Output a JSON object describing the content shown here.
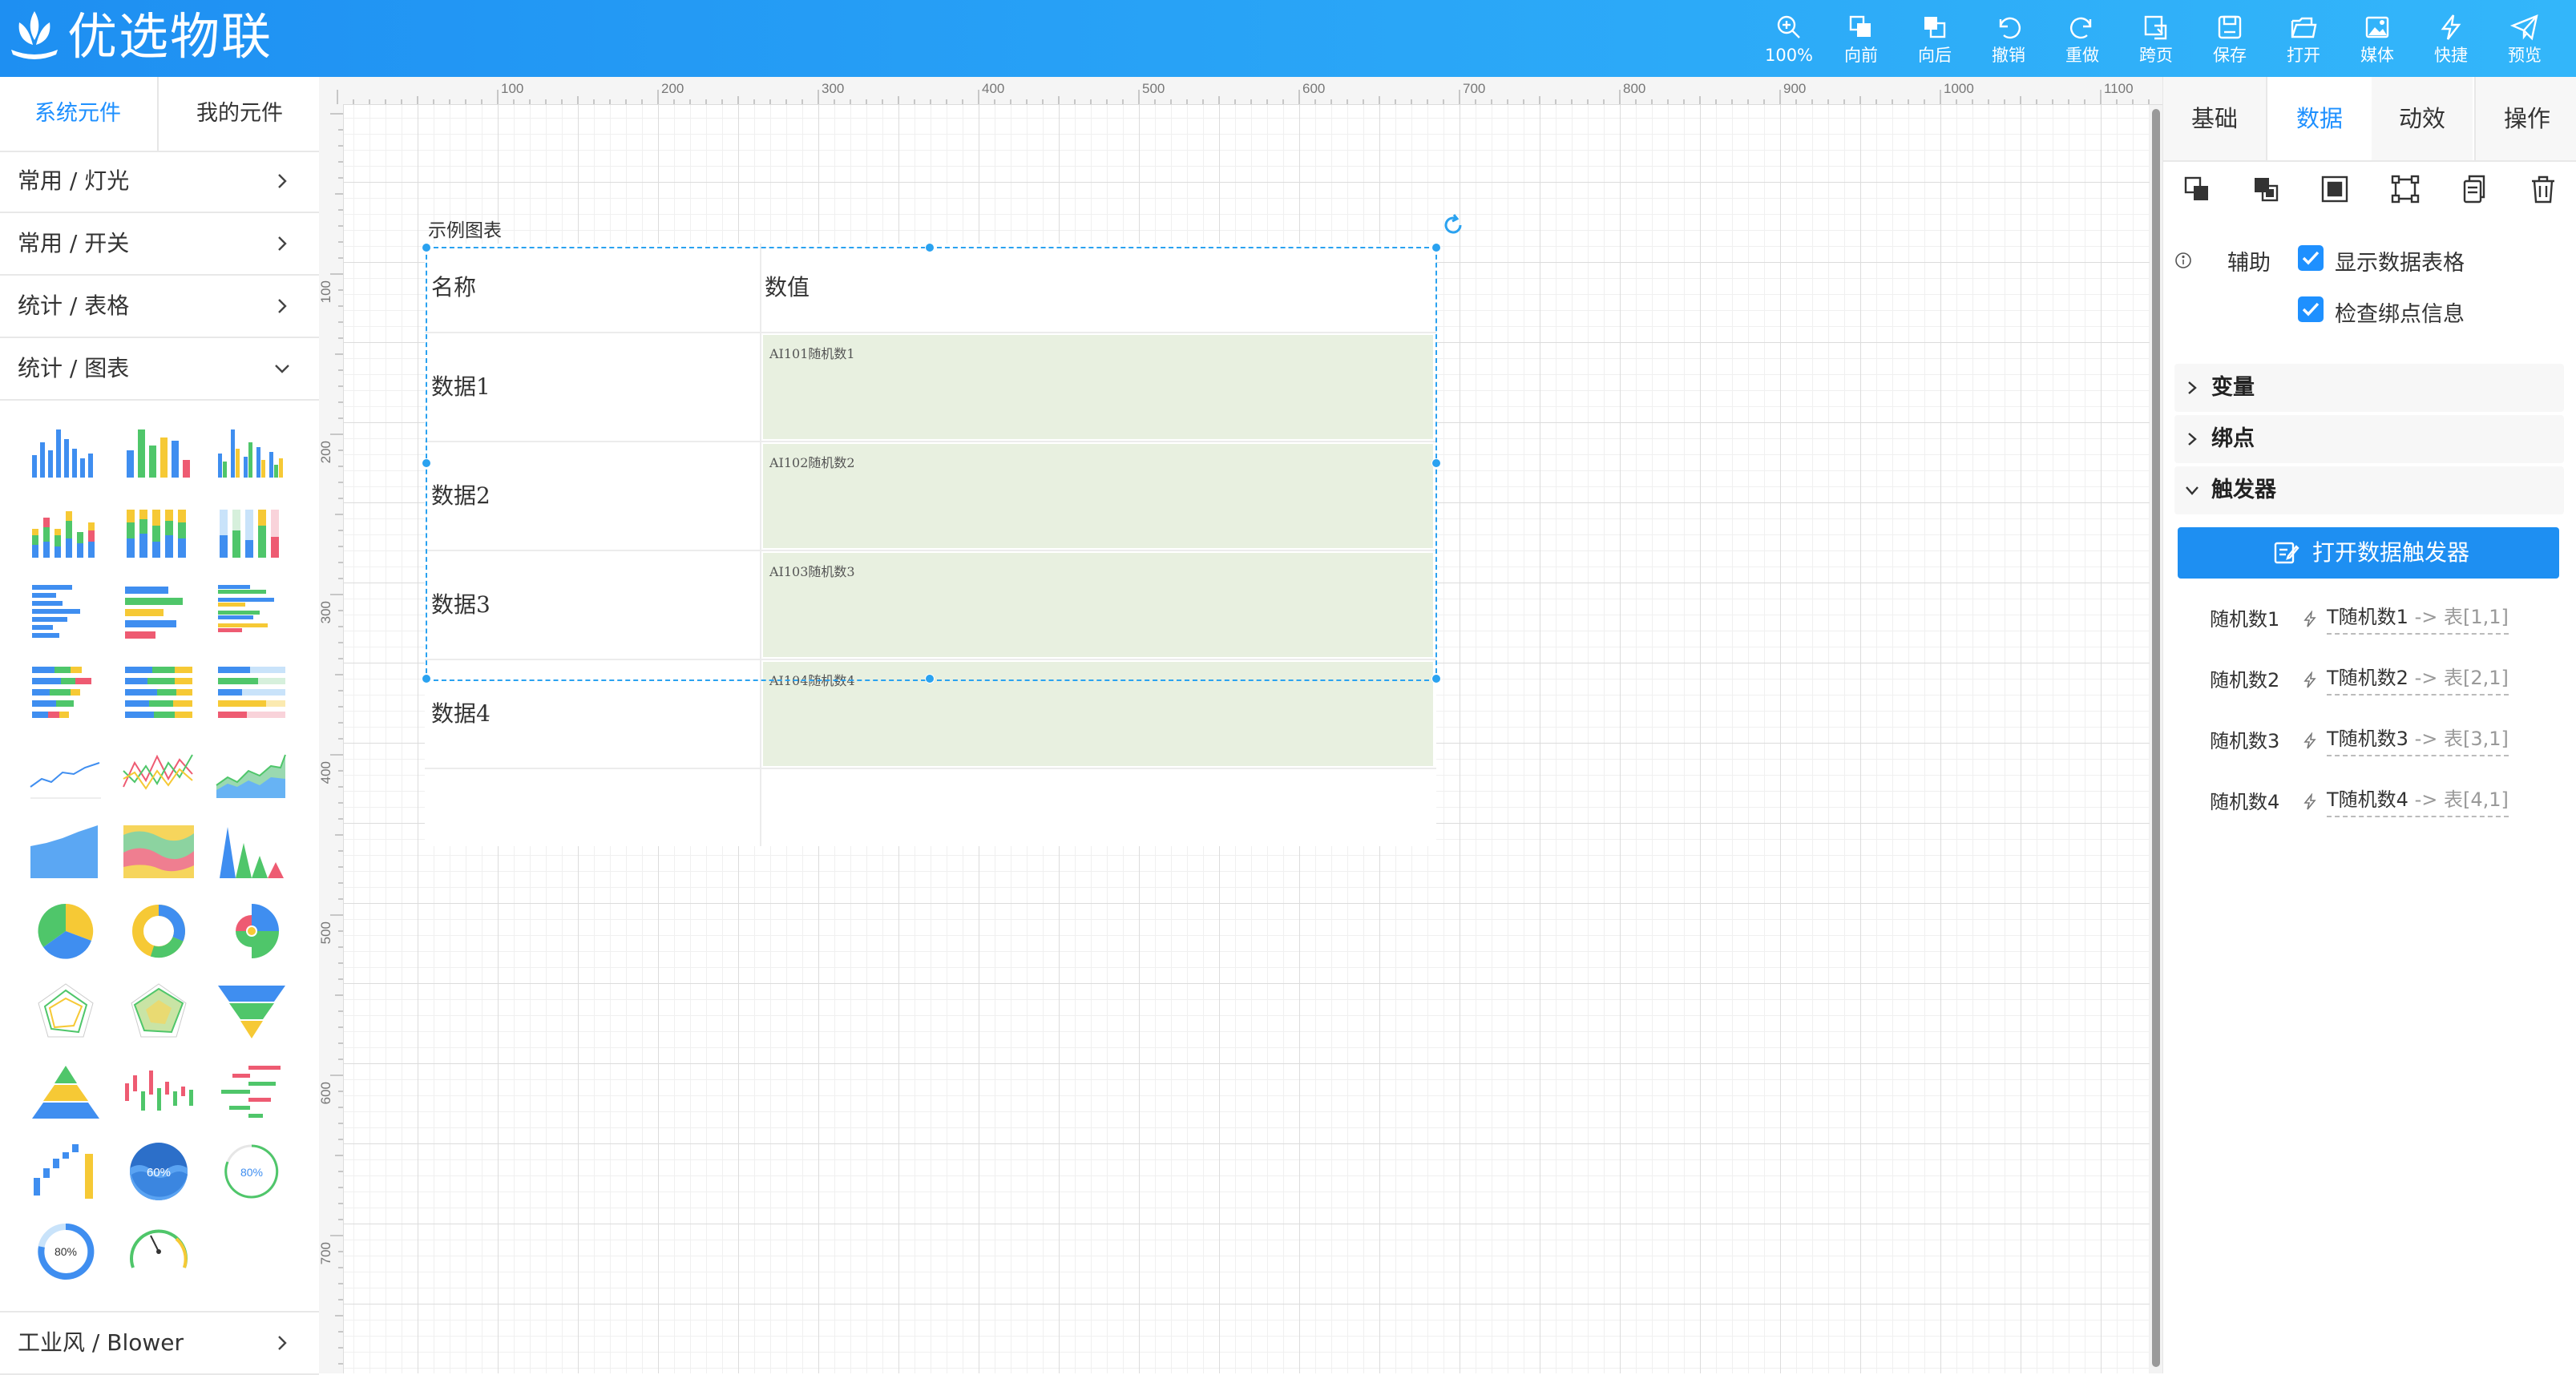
{
  "app": {
    "brand": "优选物联"
  },
  "toolbar": {
    "zoom": "100%",
    "forward": "向前",
    "backward": "向后",
    "undo": "撤销",
    "redo": "重做",
    "cross_page": "跨页",
    "save": "保存",
    "open": "打开",
    "media": "媒体",
    "shortcut": "快捷",
    "preview": "预览"
  },
  "left_panel": {
    "tabs": [
      "系统元件",
      "我的元件"
    ],
    "categories": [
      "常用 / 灯光",
      "常用 / 开关",
      "统计 / 表格",
      "统计 / 图表"
    ],
    "bottom_category": "工业风 / Blower",
    "thumb_labels": {
      "gauge_wave": "60%",
      "ring_gauge": "80%",
      "circle_gauge": "80%"
    }
  },
  "canvas": {
    "ruler_top": [
      "100",
      "200",
      "300",
      "400",
      "500",
      "600",
      "700",
      "800",
      "900",
      "1000",
      "1100"
    ],
    "ruler_left": [
      "100",
      "200",
      "300",
      "400",
      "500",
      "600",
      "700"
    ],
    "chart_title": "示例图表",
    "table": {
      "headers": [
        "名称",
        "数值"
      ],
      "rows": [
        {
          "name": "数据1",
          "value": "AI101随机数1"
        },
        {
          "name": "数据2",
          "value": "AI102随机数2"
        },
        {
          "name": "数据3",
          "value": "AI103随机数3"
        },
        {
          "name": "数据4",
          "value": "AI104随机数4"
        }
      ]
    }
  },
  "right_panel": {
    "tabs": [
      "基础",
      "数据",
      "动效",
      "操作"
    ],
    "active_tab": "数据",
    "assist_label": "辅助",
    "show_data_table": "显示数据表格",
    "check_binding": "检查绑点信息",
    "sections": [
      "变量",
      "绑点",
      "触发器"
    ],
    "open_trigger_button": "打开数据触发器",
    "triggers": [
      {
        "name": "随机数1",
        "target": "T随机数1",
        "arrow": "->",
        "dest": "表[1,1]"
      },
      {
        "name": "随机数2",
        "target": "T随机数2",
        "arrow": "->",
        "dest": "表[2,1]"
      },
      {
        "name": "随机数3",
        "target": "T随机数3",
        "arrow": "->",
        "dest": "表[3,1]"
      },
      {
        "name": "随机数4",
        "target": "T随机数4",
        "arrow": "->",
        "dest": "表[4,1]"
      }
    ]
  },
  "colors": {
    "accent": "#1e90ff",
    "topbar": "#1e8ff2",
    "selection": "#2aa2f0",
    "value_cell": "#e8f0e0"
  }
}
